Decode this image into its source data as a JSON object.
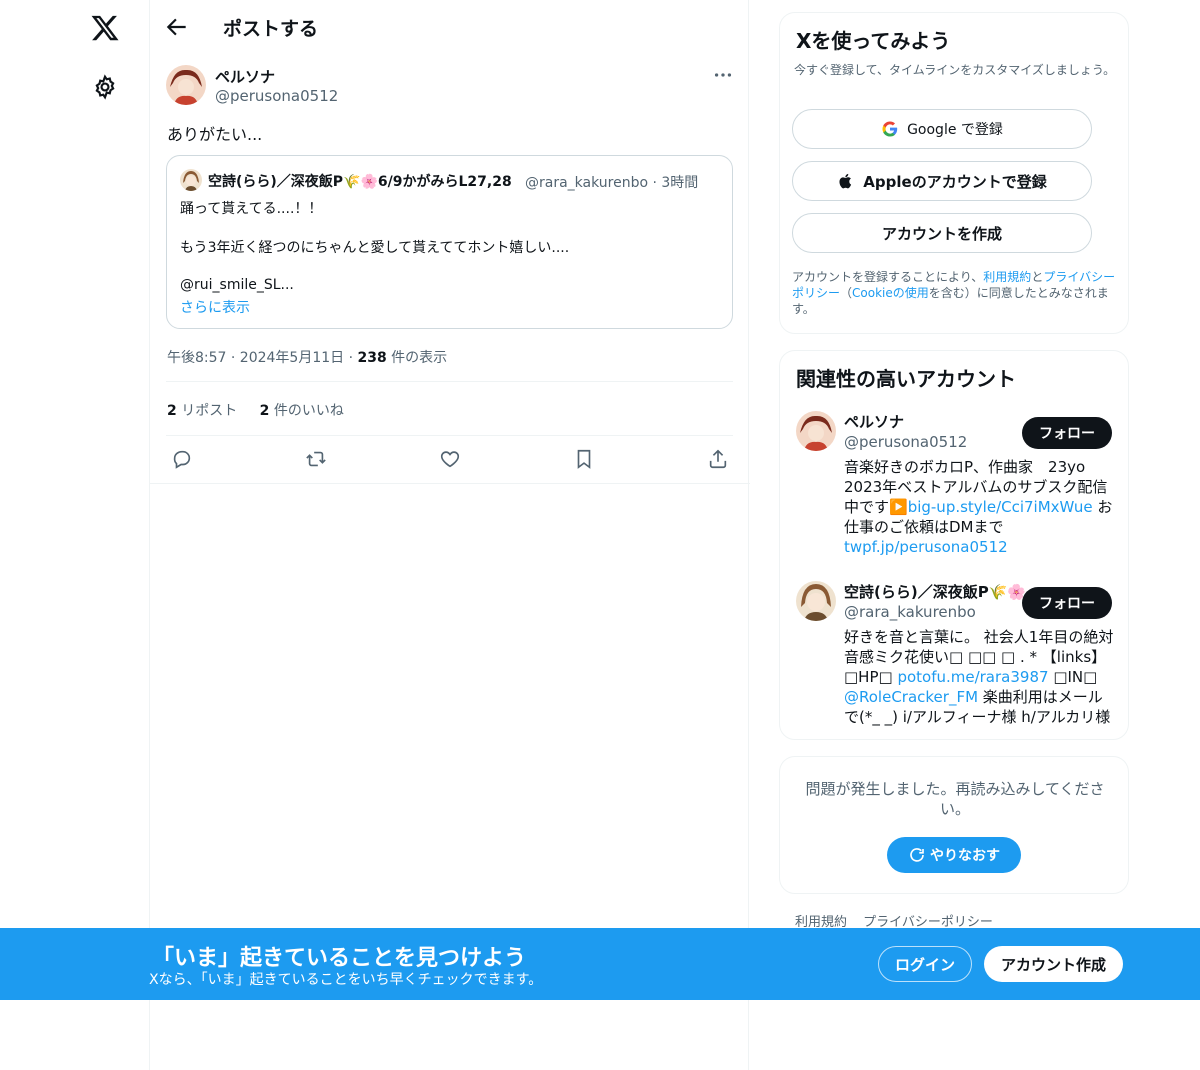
{
  "header": {
    "title": "ポストする"
  },
  "post": {
    "author_name": "ペルソナ",
    "author_handle": "@perusona0512",
    "text": "ありがたい...",
    "timestamp": "午後8:57 · 2024年5月11日 · ",
    "views_count": "238",
    "views_label": " 件の表示",
    "reposts_count": "2",
    "reposts_label": " リポスト",
    "likes_count": "2",
    "likes_label": " 件のいいね"
  },
  "quote": {
    "author_name": "空詩(らら)／深夜飯P🌾🌸6/9かがみらL27,28",
    "meta": "@rara_kakurenbo · 3時間",
    "line1": "踊って貰えてる....！！",
    "line2": "もう3年近く経つのにちゃんと愛して貰えててホント嬉しい....",
    "line3": "@rui_smile_SL...",
    "show_more": "さらに表示"
  },
  "signup": {
    "title": "Xを使ってみよう",
    "subtitle": "今すぐ登録して、タイムラインをカスタマイズしましょう。",
    "google_label": "Google で登録",
    "apple_label": "Appleのアカウントで登録",
    "create_label": "アカウントを作成",
    "legal_pre": "アカウントを登録することにより、",
    "legal_terms": "利用規約",
    "legal_and": "と",
    "legal_privacy": "プライバシーポリシー",
    "legal_mid": "（",
    "legal_cookie": "Cookieの使用",
    "legal_post": "を含む）に同意したとみなされます。"
  },
  "related": {
    "title": "関連性の高いアカウント",
    "accounts": [
      {
        "name": "ペルソナ",
        "handle": "@perusona0512",
        "follow_label": "フォロー",
        "bio_1": "音楽好きのボカロP、作曲家　23yo 2023年ベストアルバムのサブスク配信中です▶️",
        "bio_link1": "big-up.style/Cci7iMxWue",
        "bio_2": " お仕事のご依頼はDMまで ",
        "bio_link2": "twpf.jp/perusona0512"
      },
      {
        "name": "空詩(らら)／深夜飯P🌾🌸",
        "handle": "@rara_kakurenbo",
        "follow_label": "フォロー",
        "bio_1": "好きを音と言葉に。 社会人1年目の絶対音感ミク花使い□ □□ □ . * 【links】□HP□ ",
        "bio_link1": "potofu.me/rara3987",
        "bio_2": " □IN□ ",
        "bio_link2": "@RoleCracker_FM",
        "bio_3": " 楽曲利用はメールで(*_ _) i/アルフィーナ様 h/アルカリ様"
      }
    ]
  },
  "error_card": {
    "message": "問題が発生しました。再読み込みしてください。",
    "retry_label": "やりなおす"
  },
  "footer": {
    "terms": "利用規約",
    "privacy": "プライバシーポリシー"
  },
  "banner": {
    "title": "「いま」起きていることを見つけよう",
    "subtitle": "Xなら、「いま」起きていることをいち早くチェックできます。",
    "login_label": "ログイン",
    "signup_label": "アカウント作成"
  },
  "colors": {
    "accent": "#1d9bf0",
    "text": "#0f1419",
    "muted": "#536471",
    "border": "#eff3f4"
  },
  "icons": [
    "x-logo-icon",
    "gear-icon",
    "back-arrow-icon",
    "more-icon",
    "reply-icon",
    "repost-icon",
    "like-icon",
    "bookmark-icon",
    "share-icon",
    "google-icon",
    "apple-icon",
    "refresh-icon"
  ]
}
